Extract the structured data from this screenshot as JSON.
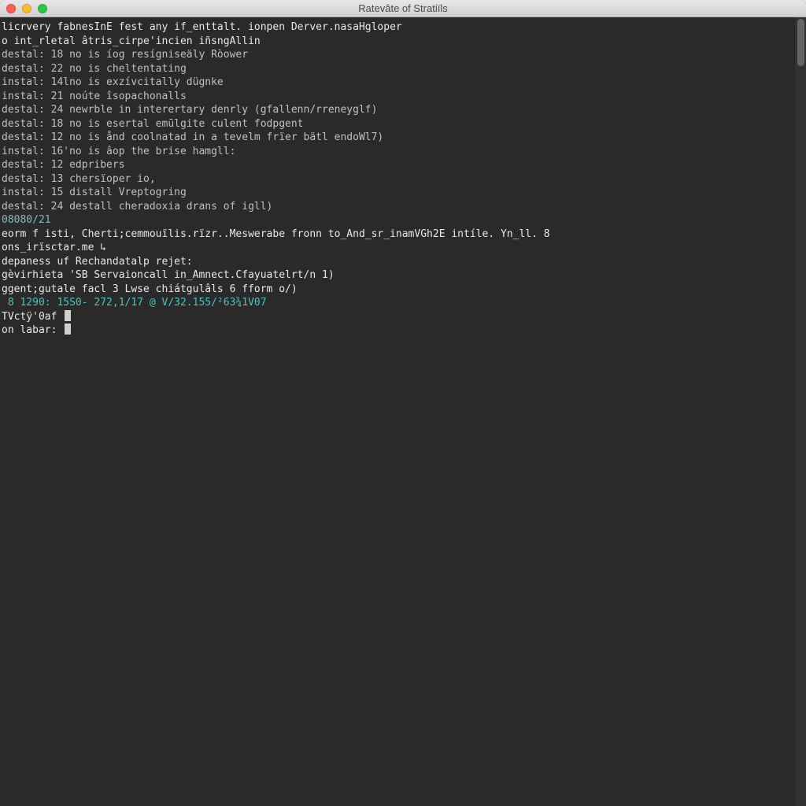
{
  "window": {
    "title": "Ratevâte of Stratiïls"
  },
  "colors": {
    "bg": "#2a2a2a",
    "fg": "#d0d0d0",
    "cyan": "#7fbfbf",
    "teal": "#4fc1c1",
    "green": "#6fbf6f"
  },
  "term": {
    "lines": [
      {
        "cls": "c-white",
        "text": "licrvery fabnesInE fest any if_enttalt. ionpen Derver.nasaHgloper"
      },
      {
        "cls": "c-dim",
        "text": ""
      },
      {
        "cls": "c-white",
        "text": "o int_rletal âtris_cirpe'incien iñsngAllin"
      },
      {
        "cls": "c-dim",
        "text": "destal: 18 no is íog resígniseäly Ròower"
      },
      {
        "cls": "c-dim",
        "text": "destal: 22 no is cheltentating"
      },
      {
        "cls": "c-dim",
        "text": "instal: 14lno is exzívcitally dügnke"
      },
      {
        "cls": "c-dim",
        "text": "instal: 21 noúte îsopachonalls"
      },
      {
        "cls": "c-dim",
        "text": "destal: 24 newrble in interertary denrly (gfallenn/rreneyglf)"
      },
      {
        "cls": "c-dim",
        "text": "destal: 18 no is esertal emūlgite culent fodpgent"
      },
      {
        "cls": "c-dim",
        "text": "destal: 12 no is ånd coolnatad in a tevelm frïer bätl endoWl7)"
      },
      {
        "cls": "c-dim",
        "text": "instal: 16'no is âop the brise hamgll:"
      },
      {
        "cls": "c-dim",
        "text": "destal: 12 edpribers"
      },
      {
        "cls": "c-dim",
        "text": "destal: 13 chersïoper io,"
      },
      {
        "cls": "c-dim",
        "text": "instal: 15 distall Vreptogring"
      },
      {
        "cls": "c-dim",
        "text": "destal: 24 destall cheradoxia drans of igll)"
      },
      {
        "cls": "c-cyan",
        "text": "08080/21"
      },
      {
        "cls": "c-white",
        "text": "eorm f isti, Cherti;cemmouïlis.rïzr..Meswerabe fronn to_And_sr_inamVGh2E intíle. Yn_ll. 8"
      },
      {
        "cls": "c-dim",
        "text": ""
      },
      {
        "cls": "c-white",
        "text": "ons_irïsctar.me ↳"
      },
      {
        "cls": "c-white",
        "text": "depaness uf Rechandatalp rejet:"
      },
      {
        "cls": "c-dim",
        "text": ""
      },
      {
        "cls": "c-white",
        "text": "gèvirhieta 'SB Servaioncall in_Amnect.Cfayuatelrt/n 1)"
      },
      {
        "cls": "c-dim",
        "text": ""
      },
      {
        "cls": "c-white",
        "text": "ggent;gutale facl 3 Lwse chiátgulâls 6 fform o/)"
      },
      {
        "cls": "c-dim",
        "text": ""
      },
      {
        "cls": "c-teal",
        "text": " 8 1290: 15S0- 272,1/17 @ V/32.155/²63¾1V07"
      },
      {
        "cls": "c-white",
        "text": "TVctÿ'0af ▮"
      },
      {
        "cls": "c-white",
        "text": "on labar: ▮"
      }
    ]
  }
}
